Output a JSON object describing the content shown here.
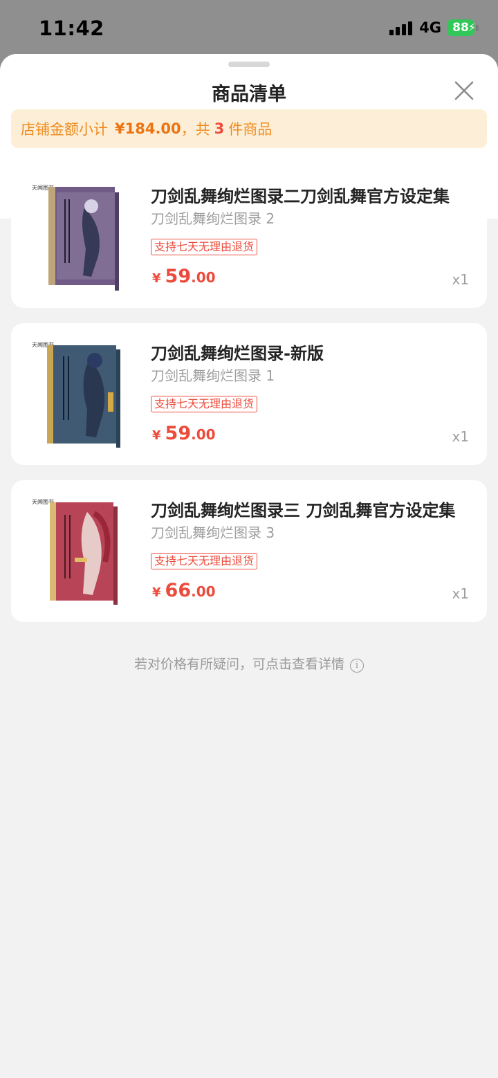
{
  "status_bar": {
    "time": "11:42",
    "network": "4G",
    "battery": "88"
  },
  "sheet": {
    "title": "商品清单",
    "subtotal": {
      "prefix": "店铺金额小计",
      "amount": "¥184.00",
      "count_prefix": "，共",
      "count": "3",
      "count_suffix": "件商品"
    },
    "items": [
      {
        "title": "刀剑乱舞绚烂图录二刀剑乱舞官方设定集",
        "subtitle": "刀剑乱舞绚烂图录 2",
        "badge": "支持七天无理由退货",
        "currency": "¥",
        "price_int": "59",
        "price_dec": ".00",
        "quantity": "x1",
        "cover_color": "#6f5b86",
        "cover_spine": "#bfa67a"
      },
      {
        "title": "刀剑乱舞绚烂图录-新版",
        "subtitle": "刀剑乱舞绚烂图录 1",
        "badge": "支持七天无理由退货",
        "currency": "¥",
        "price_int": "59",
        "price_dec": ".00",
        "quantity": "x1",
        "cover_color": "#3f5a72",
        "cover_spine": "#c9a653"
      },
      {
        "title": "刀剑乱舞绚烂图录三 刀剑乱舞官方设定集",
        "subtitle": "刀剑乱舞绚烂图录 3",
        "badge": "支持七天无理由退货",
        "currency": "¥",
        "price_int": "66",
        "price_dec": ".00",
        "quantity": "x1",
        "cover_color": "#b84557",
        "cover_spine": "#d9ba72"
      }
    ],
    "price_note": "若对价格有所疑问，可点击查看详情"
  }
}
